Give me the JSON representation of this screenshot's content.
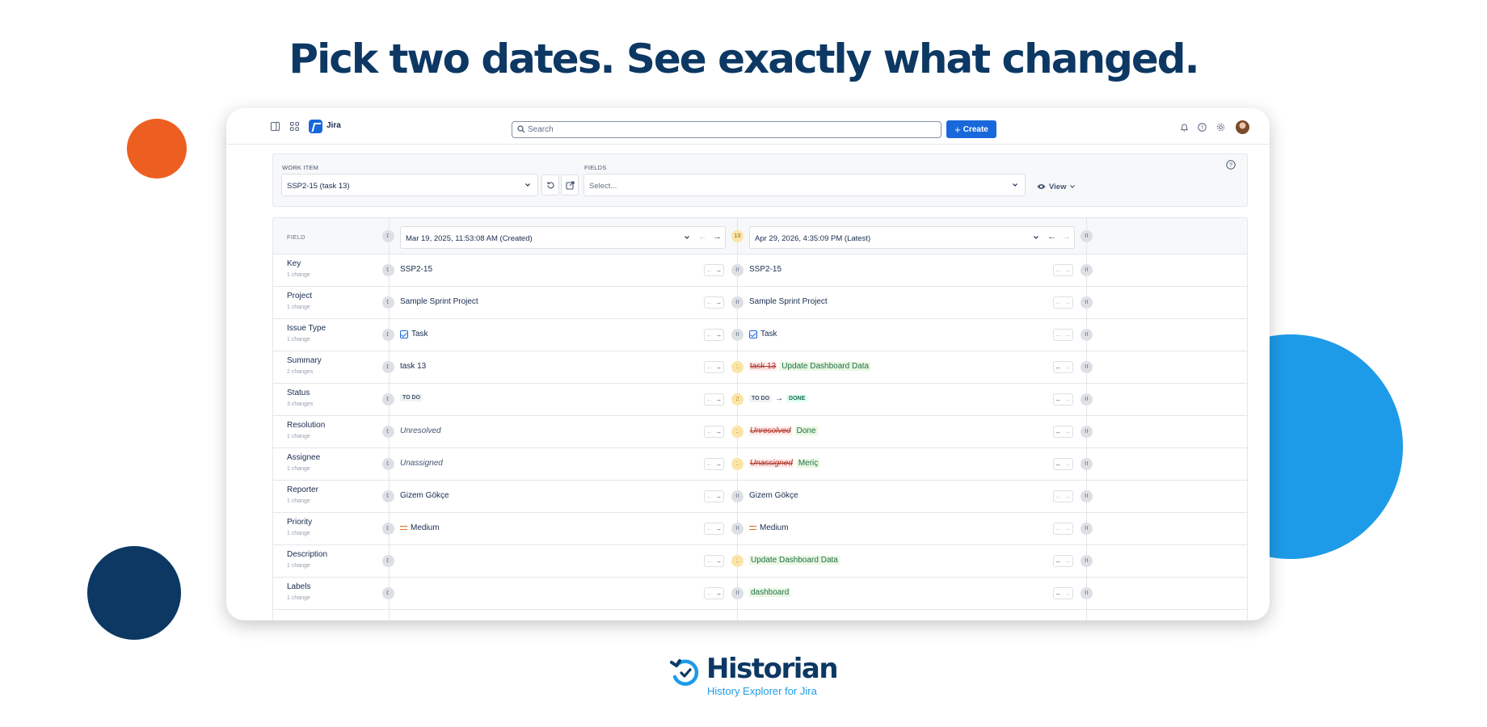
{
  "headline": "Pick two dates. See exactly what changed.",
  "colors": {
    "navy": "#0c3863",
    "orange": "#ed5f21",
    "blue": "#1e9be8",
    "jira_blue": "#1868db"
  },
  "topbar": {
    "app_name": "Jira",
    "search_placeholder": "Search",
    "create_label": "Create",
    "icons": [
      "sidebar-toggle-icon",
      "app-switcher-icon",
      "bell-icon",
      "help-icon",
      "gear-icon",
      "avatar"
    ]
  },
  "filters": {
    "work_item_label": "WORK ITEM",
    "work_item_value": "SSP2-15 (task 13)",
    "fields_label": "FIELDS",
    "fields_placeholder": "Select...",
    "view_label": "View"
  },
  "table": {
    "field_header": "FIELD",
    "left": {
      "date": "Mar 19, 2025, 11:53:08 AM (Created)",
      "count": "0"
    },
    "right": {
      "date": "Apr 29, 2026, 4:35:09 PM (Latest)",
      "count": "10",
      "end_count": "0"
    },
    "rows": [
      {
        "name": "Key",
        "changes": "1 change",
        "lc": "0",
        "lv": "SSP2-15",
        "rc": "0",
        "rv": "SSP2-15",
        "ec": "0"
      },
      {
        "name": "Project",
        "changes": "1 change",
        "lc": "0",
        "lv": "Sample Sprint Project",
        "rc": "0",
        "rv": "Sample Sprint Project",
        "ec": "0"
      },
      {
        "name": "Issue Type",
        "changes": "1 change",
        "lc": "0",
        "lv": "Task",
        "rc": "0",
        "rv": "Task",
        "ec": "0"
      },
      {
        "name": "Summary",
        "changes": "2 changes",
        "lc": "0",
        "lv": "task 13",
        "rc": "1",
        "rv_old": "task 13",
        "rv_new": "Update Dashboard Data",
        "ec": "0"
      },
      {
        "name": "Status",
        "changes": "3 changes",
        "lc": "0",
        "lv": "TO DO",
        "rc": "2",
        "rv_old": "TO DO",
        "rv_new": "DONE",
        "ec": "0"
      },
      {
        "name": "Resolution",
        "changes": "1 change",
        "lc": "0",
        "lv": "Unresolved",
        "rc": "1",
        "rv_old": "Unresolved",
        "rv_new": "Done",
        "ec": "0"
      },
      {
        "name": "Assignee",
        "changes": "1 change",
        "lc": "0",
        "lv": "Unassigned",
        "rc": "1",
        "rv_old": "Unassigned",
        "rv_new": "Meriç",
        "ec": "0"
      },
      {
        "name": "Reporter",
        "changes": "1 change",
        "lc": "0",
        "lv": "Gizem Gökçe",
        "rc": "0",
        "rv": "Gizem Gökçe",
        "ec": "0"
      },
      {
        "name": "Priority",
        "changes": "1 change",
        "lc": "0",
        "lv": "Medium",
        "rc": "0",
        "rv": "Medium",
        "ec": "0"
      },
      {
        "name": "Description",
        "changes": "1 change",
        "lc": "0",
        "lv": "",
        "rc": "1",
        "rv_new": "Update Dashboard Data",
        "ec": "0"
      },
      {
        "name": "Labels",
        "changes": "1 change",
        "lc": "0",
        "lv": "",
        "rc": "0",
        "rv_new": "dashboard",
        "ec": "0"
      }
    ]
  },
  "brand": {
    "name": "Historian",
    "tagline": "History Explorer for Jira"
  }
}
